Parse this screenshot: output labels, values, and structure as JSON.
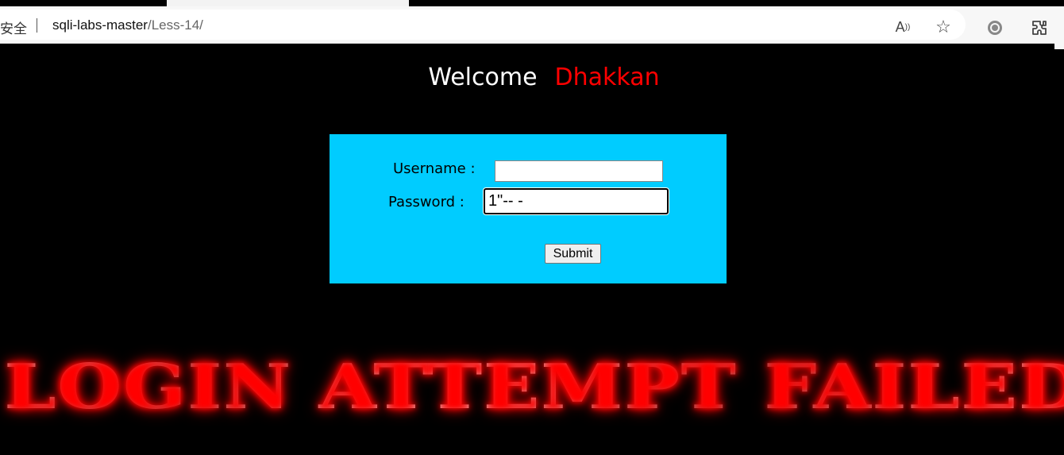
{
  "browser": {
    "security_label": "安全",
    "url_host": "sqli-labs-master",
    "url_path": "/Less-14/"
  },
  "page": {
    "welcome_text": "Welcome",
    "welcome_name": "Dhakkan",
    "username_label": "Username :",
    "password_label": "Password :",
    "username_value": "",
    "password_value": "1\"-- -",
    "submit_label": "Submit",
    "result_text": "LOGIN ATTEMPT FAILED"
  },
  "colors": {
    "page_background": "#000000",
    "form_background": "#00ccff",
    "welcome_name_color": "#ff0000",
    "result_glow": "#ff0000"
  }
}
